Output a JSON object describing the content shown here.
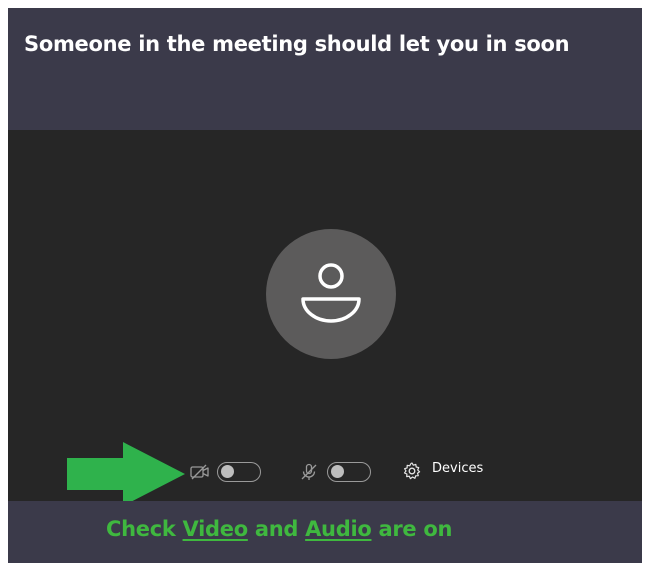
{
  "header": {
    "title": "Someone in the meeting should let you in soon"
  },
  "preview": {
    "avatar_icon": "person-icon"
  },
  "controls": {
    "camera_icon": "camera-off-icon",
    "camera_toggle": "off",
    "mic_icon": "mic-off-icon",
    "mic_toggle": "off",
    "devices_icon": "gear-icon",
    "devices_label": "Devices"
  },
  "annotation": {
    "arrow_icon": "arrow-right-icon",
    "arrow_color": "#2fb24c",
    "caption_prefix": "Check ",
    "caption_video": "Video",
    "caption_and": " and ",
    "caption_audio": "Audio",
    "caption_suffix": " are on",
    "caption_color": "#3fb83f"
  },
  "colors": {
    "header_bg": "#3b3a4a",
    "video_bg": "#262626",
    "avatar_bg": "#5c5b5b"
  }
}
